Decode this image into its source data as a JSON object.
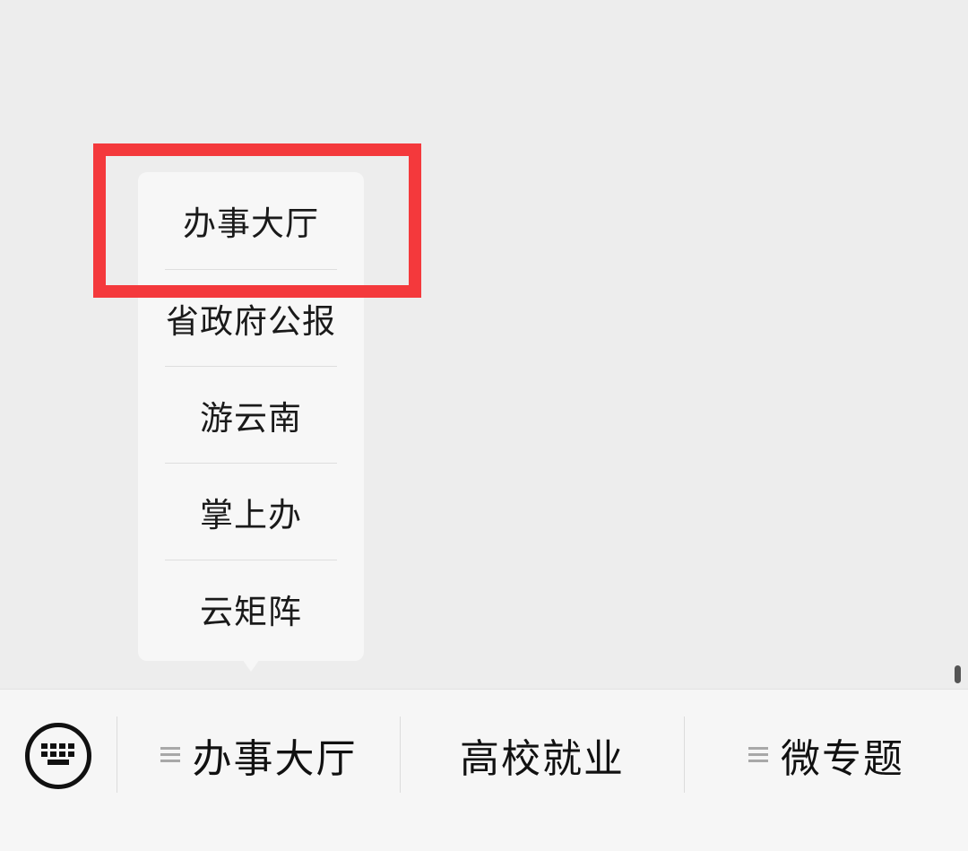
{
  "popup_menu": {
    "items": [
      {
        "label": "办事大厅"
      },
      {
        "label": "省政府公报"
      },
      {
        "label": "游云南"
      },
      {
        "label": "掌上办"
      },
      {
        "label": "云矩阵"
      }
    ],
    "highlighted_index": 0,
    "highlight_color": "#f4393c"
  },
  "bottom_menu": {
    "keyboard_icon": "keyboard-icon",
    "tabs": [
      {
        "label": "办事大厅",
        "has_submenu": true
      },
      {
        "label": "高校就业",
        "has_submenu": false
      },
      {
        "label": "微专题",
        "has_submenu": true
      }
    ]
  }
}
